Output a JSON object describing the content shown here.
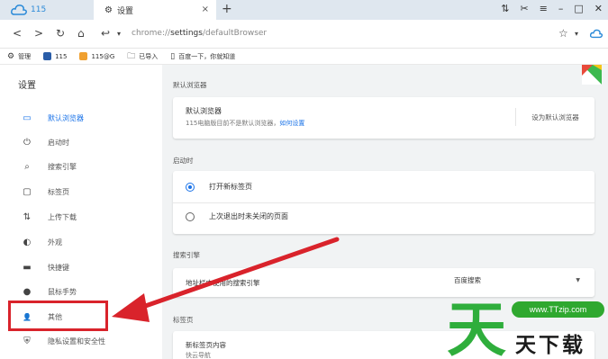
{
  "titlebar": {
    "tab1_label": "115",
    "tab2_label": "设置",
    "tab2_close": "×",
    "new_tab": "+",
    "window_controls": [
      "⇅",
      "✂",
      "≡",
      "–",
      "□",
      "✕"
    ]
  },
  "toolbar": {
    "back": "<",
    "forward": ">",
    "reload": "↻",
    "home": "⌂",
    "undo": "↩",
    "dropdown": "▾",
    "url_scheme": "chrome://",
    "url_host": "settings",
    "url_path": "/defaultBrowser",
    "star": "☆",
    "menu": "▾"
  },
  "bookmarks": [
    {
      "label": "管理",
      "color": "#555555"
    },
    {
      "label": "115",
      "color": "#2a5da8"
    },
    {
      "label": "115@G",
      "color": "#f0a030"
    },
    {
      "label": "已导入",
      "color": "#777777"
    },
    {
      "label": "百度一下，你就知道",
      "color": "#777777"
    }
  ],
  "sidebar": {
    "title": "设置",
    "items": [
      {
        "label": "默认浏览器",
        "icon": "▭"
      },
      {
        "label": "启动时",
        "icon": "⏻"
      },
      {
        "label": "搜索引擎",
        "icon": "⌕"
      },
      {
        "label": "标签页",
        "icon": "▢"
      },
      {
        "label": "上传下载",
        "icon": "⇅"
      },
      {
        "label": "外观",
        "icon": "◐"
      },
      {
        "label": "快捷键",
        "icon": "▬"
      },
      {
        "label": "鼠标手势",
        "icon": "●"
      },
      {
        "label": "其他",
        "icon": "👤"
      },
      {
        "label": "隐私设置和安全性",
        "icon": "⛨"
      }
    ]
  },
  "main": {
    "default_browser_section": "默认浏览器",
    "default_browser_title": "默认浏览器",
    "default_browser_sub": "115电脑版目前不是默认浏览器，",
    "default_browser_link": "如何设置",
    "set_default_button": "设为默认浏览器",
    "startup_section": "启动时",
    "startup_option1": "打开新标签页",
    "startup_option2": "上次退出时未关闭的页面",
    "search_section": "搜索引擎",
    "search_row_label": "地址栏中使用的搜索引擎",
    "search_engine_value": "百度搜索",
    "tabs_section": "标签页",
    "new_tab_content_title": "新标签页内容",
    "new_tab_content_sub": "快云导航"
  },
  "watermark": {
    "big_char": "天",
    "url": "www.TTzip.com",
    "text": "天下载"
  },
  "colors": {
    "accent": "#1a73e8",
    "annotation_red": "#d9232b",
    "watermark_green": "#2fae3c"
  }
}
